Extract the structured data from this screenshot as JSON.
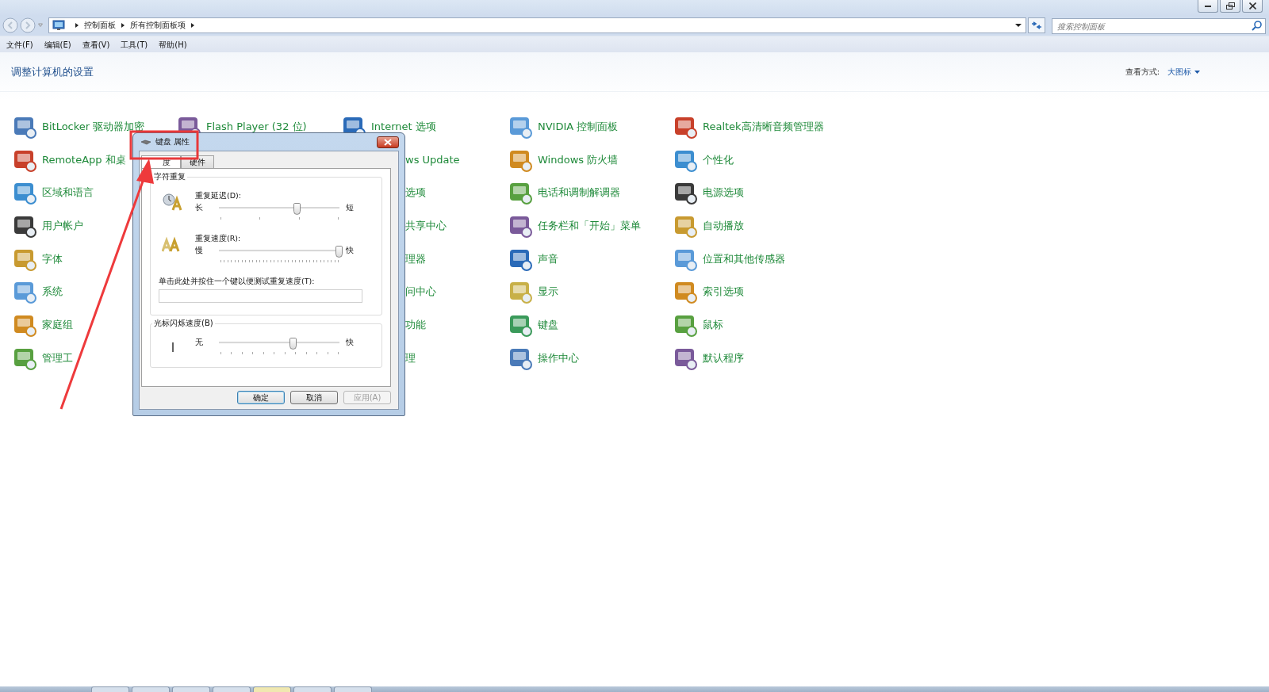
{
  "address_bar": {
    "breadcrumbs": [
      "控制面板",
      "所有控制面板项"
    ],
    "search": {
      "placeholder": "搜索控制面板"
    }
  },
  "menu": [
    "文件(F)",
    "编辑(E)",
    "查看(V)",
    "工具(T)",
    "帮助(H)"
  ],
  "header": {
    "title": "调整计算机的设置",
    "view_label": "查看方式:",
    "view_value": "大图标"
  },
  "columns": [
    {
      "items": [
        {
          "label": "BitLocker 驱动器加密",
          "covered": false
        },
        {
          "label": "RemoteApp 和桌",
          "covered": false
        },
        {
          "label": "区域和语言",
          "covered": false
        },
        {
          "label": "用户帐户",
          "covered": false
        },
        {
          "label": "字体",
          "covered": false
        },
        {
          "label": "系统",
          "covered": false
        },
        {
          "label": "家庭组",
          "covered": false
        },
        {
          "label": "管理工",
          "covered": false
        }
      ]
    },
    {
      "items": [
        {
          "label": "Flash Player (32 位)",
          "covered": false
        }
      ]
    },
    {
      "items": [
        {
          "label": "Internet 选项",
          "covered": false
        },
        {
          "label": "ws Update",
          "covered": true
        },
        {
          "label": "选项",
          "covered": true
        },
        {
          "label": "共享中心",
          "covered": true
        },
        {
          "label": "理器",
          "covered": true
        },
        {
          "label": "问中心",
          "covered": true
        },
        {
          "label": "功能",
          "covered": true
        },
        {
          "label": "理",
          "covered": true
        }
      ]
    },
    {
      "items": [
        {
          "label": "NVIDIA 控制面板",
          "covered": false
        },
        {
          "label": "Windows 防火墙",
          "covered": false
        },
        {
          "label": "电话和调制解调器",
          "covered": false
        },
        {
          "label": "任务栏和「开始」菜单",
          "covered": false
        },
        {
          "label": "声音",
          "covered": false
        },
        {
          "label": "显示",
          "covered": false
        },
        {
          "label": "键盘",
          "covered": false
        },
        {
          "label": "操作中心",
          "covered": false
        }
      ]
    },
    {
      "items": [
        {
          "label": "Realtek高清晰音频管理器",
          "covered": false
        },
        {
          "label": "个性化",
          "covered": false
        },
        {
          "label": "电源选项",
          "covered": false
        },
        {
          "label": "自动播放",
          "covered": false
        },
        {
          "label": "位置和其他传感器",
          "covered": false
        },
        {
          "label": "索引选项",
          "covered": false
        },
        {
          "label": "鼠标",
          "covered": false
        },
        {
          "label": "默认程序",
          "covered": false
        }
      ]
    }
  ],
  "dialog": {
    "title": "键盘 属性",
    "tabs": [
      {
        "label": "度",
        "selected": true
      },
      {
        "label": "硬件",
        "selected": false
      }
    ],
    "groups": [
      {
        "title": "字符重复",
        "rows": [
          {
            "kind": "slider",
            "label": "重复延迟(D):",
            "min_label": "长",
            "max_label": "短",
            "level": 0.65
          },
          {
            "kind": "slider",
            "label": "重复速度(R):",
            "min_label": "慢",
            "max_label": "快",
            "level": 1.0
          },
          {
            "kind": "field",
            "label": "单击此处并按住一个键以便测试重复速度(T):"
          }
        ]
      },
      {
        "title": "光标闪烁速度(B)",
        "rows": [
          {
            "kind": "slider",
            "min_label": "无",
            "max_label": "快",
            "level": 0.62
          }
        ]
      }
    ],
    "buttons": [
      {
        "label": "确定",
        "default": true,
        "disabled": false
      },
      {
        "label": "取消",
        "default": false,
        "disabled": false
      },
      {
        "label": "应用(A)",
        "default": false,
        "disabled": true
      }
    ]
  }
}
